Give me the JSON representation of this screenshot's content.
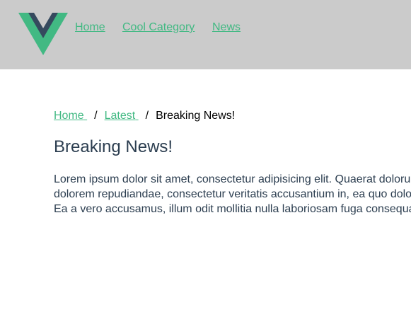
{
  "colors": {
    "accent": "#42b983",
    "logo_dark": "#35495e",
    "header_bg": "#cbcbcb",
    "text": "#2c3e50"
  },
  "header": {
    "logo_icon": "vue-logo-icon",
    "nav": [
      {
        "label": "Home"
      },
      {
        "label": "Cool Category"
      },
      {
        "label": "News"
      }
    ]
  },
  "breadcrumb": {
    "items": [
      {
        "label": "Home"
      },
      {
        "label": "Latest"
      }
    ],
    "separator": "/",
    "current": "Breaking News!"
  },
  "article": {
    "title": "Breaking News!",
    "lines": [
      "Lorem ipsum dolor sit amet, consectetur adipisicing elit. Quaerat dolorum",
      "dolorem repudiandae, consectetur veritatis accusantium in, ea quo dolore",
      "Ea a vero accusamus, illum odit mollitia nulla laboriosam fuga consequatur"
    ]
  }
}
